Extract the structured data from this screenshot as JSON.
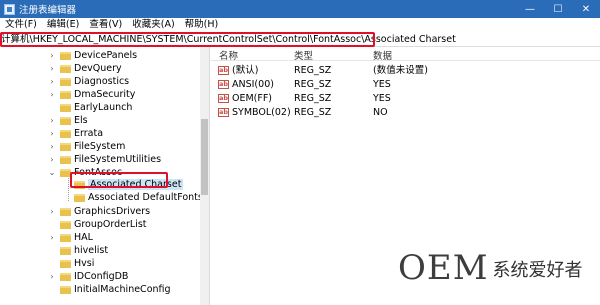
{
  "window": {
    "title": "注册表编辑器",
    "controls": [
      "—",
      "☐",
      "✕"
    ]
  },
  "menu": [
    "文件(F)",
    "编辑(E)",
    "查看(V)",
    "收藏夹(A)",
    "帮助(H)"
  ],
  "address": "计算机\\HKEY_LOCAL_MACHINE\\SYSTEM\\CurrentControlSet\\Control\\FontAssoc\\Associated Charset",
  "tree": [
    {
      "label": "DevicePanels",
      "expandable": true
    },
    {
      "label": "DevQuery",
      "expandable": true
    },
    {
      "label": "Diagnostics",
      "expandable": true
    },
    {
      "label": "DmaSecurity",
      "expandable": true
    },
    {
      "label": "EarlyLaunch",
      "expandable": false
    },
    {
      "label": "Els",
      "expandable": true
    },
    {
      "label": "Errata",
      "expandable": true
    },
    {
      "label": "FileSystem",
      "expandable": true
    },
    {
      "label": "FileSystemUtilities",
      "expandable": true
    },
    {
      "label": "FontAssoc",
      "expandable": true,
      "expanded": true
    },
    {
      "label": "Associated Charset",
      "child": true,
      "selected": true
    },
    {
      "label": "Associated DefaultFonts",
      "child": true
    },
    {
      "label": "GraphicsDrivers",
      "expandable": true
    },
    {
      "label": "GroupOrderList",
      "expandable": false
    },
    {
      "label": "HAL",
      "expandable": true
    },
    {
      "label": "hivelist",
      "expandable": false
    },
    {
      "label": "Hvsi",
      "expandable": false
    },
    {
      "label": "IDConfigDB",
      "expandable": true
    },
    {
      "label": "InitialMachineConfig",
      "expandable": false
    }
  ],
  "list": {
    "headers": [
      "名称",
      "类型",
      "数据"
    ],
    "rows": [
      {
        "name": "(默认)",
        "type": "REG_SZ",
        "data": "(数值未设置)"
      },
      {
        "name": "ANSI(00)",
        "type": "REG_SZ",
        "data": "YES"
      },
      {
        "name": "OEM(FF)",
        "type": "REG_SZ",
        "data": "YES"
      },
      {
        "name": "SYMBOL(02)",
        "type": "REG_SZ",
        "data": "NO"
      }
    ],
    "value_icon": "ab"
  },
  "watermark": {
    "brand": "OEM",
    "site": "系统爱好者"
  },
  "colors": {
    "titlebar": "#2b6cb8",
    "highlight": "#e0102a",
    "selection": "#cce4f7",
    "folder": "#e8c24d"
  }
}
